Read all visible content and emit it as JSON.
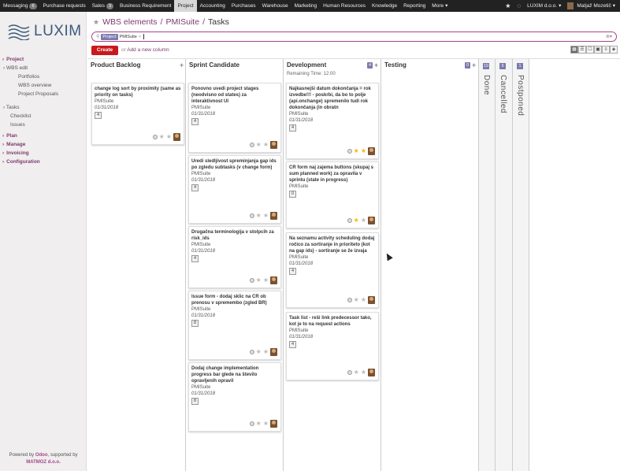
{
  "topbar": {
    "items": [
      {
        "label": "Messaging",
        "badge": "6"
      },
      {
        "label": "Purchase requests",
        "badge": ""
      },
      {
        "label": "Sales",
        "badge": "3"
      },
      {
        "label": "Business Requirement",
        "badge": ""
      },
      {
        "label": "Project",
        "badge": "",
        "active": true
      },
      {
        "label": "Accounting",
        "badge": ""
      },
      {
        "label": "Purchases",
        "badge": ""
      },
      {
        "label": "Warehouse",
        "badge": ""
      },
      {
        "label": "Marketing",
        "badge": ""
      },
      {
        "label": "Human Resources",
        "badge": ""
      },
      {
        "label": "Knowledge",
        "badge": ""
      },
      {
        "label": "Reporting",
        "badge": ""
      },
      {
        "label": "More",
        "badge": ""
      }
    ],
    "company": "LUXIM d.o.o.",
    "user": "Matjaž Mozetič"
  },
  "sidebar": {
    "logo_text": "LUXIM",
    "menu": [
      {
        "level": "l1",
        "label": "Project"
      },
      {
        "level": "l2",
        "label": "WBS edit"
      },
      {
        "level": "l3",
        "label": "Portfolios"
      },
      {
        "level": "l3",
        "label": "WBS overview"
      },
      {
        "level": "l3",
        "label": "Project Proposals"
      },
      {
        "level": "l2",
        "label": "Tasks"
      },
      {
        "level": "l2b",
        "label": "Checklist"
      },
      {
        "level": "l2b",
        "label": "Issues"
      },
      {
        "level": "l1",
        "label": "Plan"
      },
      {
        "level": "l1",
        "label": "Manage"
      },
      {
        "level": "l1",
        "label": "Invoicing"
      },
      {
        "level": "l1",
        "label": "Configuration"
      }
    ],
    "powered_prefix": "Powered by",
    "powered_brand": "Odoo",
    "powered_mid": ", supported by",
    "powered_company": "MATMOZ d.o.o."
  },
  "breadcrumb": {
    "part1": "WBS elements",
    "sep": "/",
    "part2": "PMISuite",
    "part3": "Tasks"
  },
  "search": {
    "facet_label": "Project",
    "facet_value": "PMISuite",
    "remove": "×"
  },
  "actions": {
    "create": "Create",
    "or": "or",
    "add_column": "Add a new column"
  },
  "columns": [
    {
      "title": "Product Backlog",
      "badge": "",
      "sub": ""
    },
    {
      "title": "Sprint Candidate",
      "badge": "",
      "sub": ""
    },
    {
      "title": "Development",
      "badge": "4",
      "sub": "Remaining Time: 12:00"
    },
    {
      "title": "Testing",
      "badge": "0",
      "sub": ""
    }
  ],
  "folded": [
    {
      "title": "Done",
      "badge": "19"
    },
    {
      "title": "Cancelled",
      "badge": "9"
    },
    {
      "title": "Postponed",
      "badge": "1"
    }
  ],
  "cards": {
    "backlog": [
      {
        "title": "change log sort by proximity (same as priority on tasks)",
        "project": "PMISuite",
        "date": "01/31/2018",
        "num": "4",
        "stars": 0
      }
    ],
    "sprint": [
      {
        "title": "Ponovno uvedi project stages (neodvisno od states) za interaktivnost UI",
        "project": "PMISuite",
        "date": "01/31/2018",
        "num": "4",
        "stars": 0
      },
      {
        "title": "Uredi sledljivost spreminjanja gap ids po zgledu subtasks (v change form)",
        "project": "PMISuite",
        "date": "01/31/2018",
        "num": "4",
        "stars": 0
      },
      {
        "title": "Drugačna terminologija v stolpcih za risk_ids",
        "project": "PMISuite",
        "date": "01/31/2018",
        "num": "4",
        "stars": 0
      },
      {
        "title": "Issue form - dodaj sklic na CR ob prenosu v spremembo (zgled BR)",
        "project": "PMISuite",
        "date": "01/31/2018",
        "num": "8",
        "stars": 0
      },
      {
        "title": "Dodaj change implementation progress bar glede na število opravljenih opravil",
        "project": "PMISuite",
        "date": "01/31/2018",
        "num": "8",
        "stars": 0
      }
    ],
    "development": [
      {
        "title": "Najkasnejši datum dokončanja = rok izvedbe!!! - poskrbi, da bo to polje (api.onchange) spremenilo tudi rok dokončanja (in obratn",
        "project": "PMISuite",
        "date": "01/31/2018",
        "num": "4",
        "stars": 2
      },
      {
        "title": "CR form naj zajema buttons (skupaj s sum planned work) za opravila v sprintu (state in progress)",
        "project": "PMISuite",
        "date": "",
        "num": "0",
        "stars": 1
      },
      {
        "title": "Na seznamu activity scheduling dodaj ročico za sortiranje in prioriteto (kot na gap ids) - sortiranje se že izvaja",
        "project": "PMISuite",
        "date": "01/31/2018",
        "num": "4",
        "stars": 0
      },
      {
        "title": "Task list - reši link predecessor tako, kot je to na request actions",
        "project": "PMISuite",
        "date": "01/31/2018",
        "num": "4",
        "stars": 0
      }
    ]
  }
}
